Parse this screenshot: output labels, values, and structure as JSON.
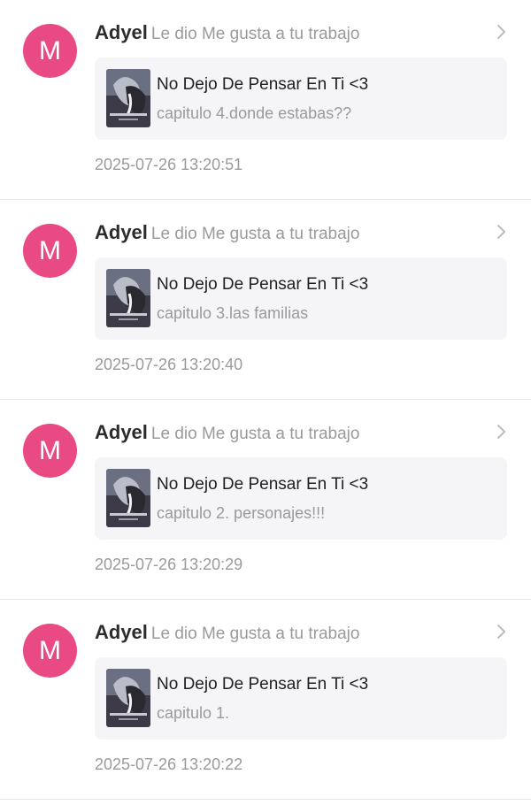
{
  "colors": {
    "avatar_bg": "#ea4a84",
    "card_bg": "#f5f5f7",
    "muted_text": "#9a9a9a"
  },
  "notifications": [
    {
      "avatar_letter": "M",
      "username": "Adyel",
      "action": "Le dio Me gusta a tu trabajo",
      "work_title": "No Dejo De Pensar En Ti <3",
      "chapter": "capitulo 4.donde estabas??",
      "timestamp": "2025-07-26 13:20:51",
      "icon": "chevron-right-icon"
    },
    {
      "avatar_letter": "M",
      "username": "Adyel",
      "action": "Le dio Me gusta a tu trabajo",
      "work_title": "No Dejo De Pensar En Ti <3",
      "chapter": "capitulo 3.las familias",
      "timestamp": "2025-07-26 13:20:40",
      "icon": "chevron-right-icon"
    },
    {
      "avatar_letter": "M",
      "username": "Adyel",
      "action": "Le dio Me gusta a tu trabajo",
      "work_title": "No Dejo De Pensar En Ti <3",
      "chapter": "capitulo 2. personajes!!!",
      "timestamp": "2025-07-26 13:20:29",
      "icon": "chevron-right-icon"
    },
    {
      "avatar_letter": "M",
      "username": "Adyel",
      "action": "Le dio Me gusta a tu trabajo",
      "work_title": "No Dejo De Pensar En Ti <3",
      "chapter": "capitulo 1.",
      "timestamp": "2025-07-26 13:20:22",
      "icon": "chevron-right-icon"
    }
  ]
}
